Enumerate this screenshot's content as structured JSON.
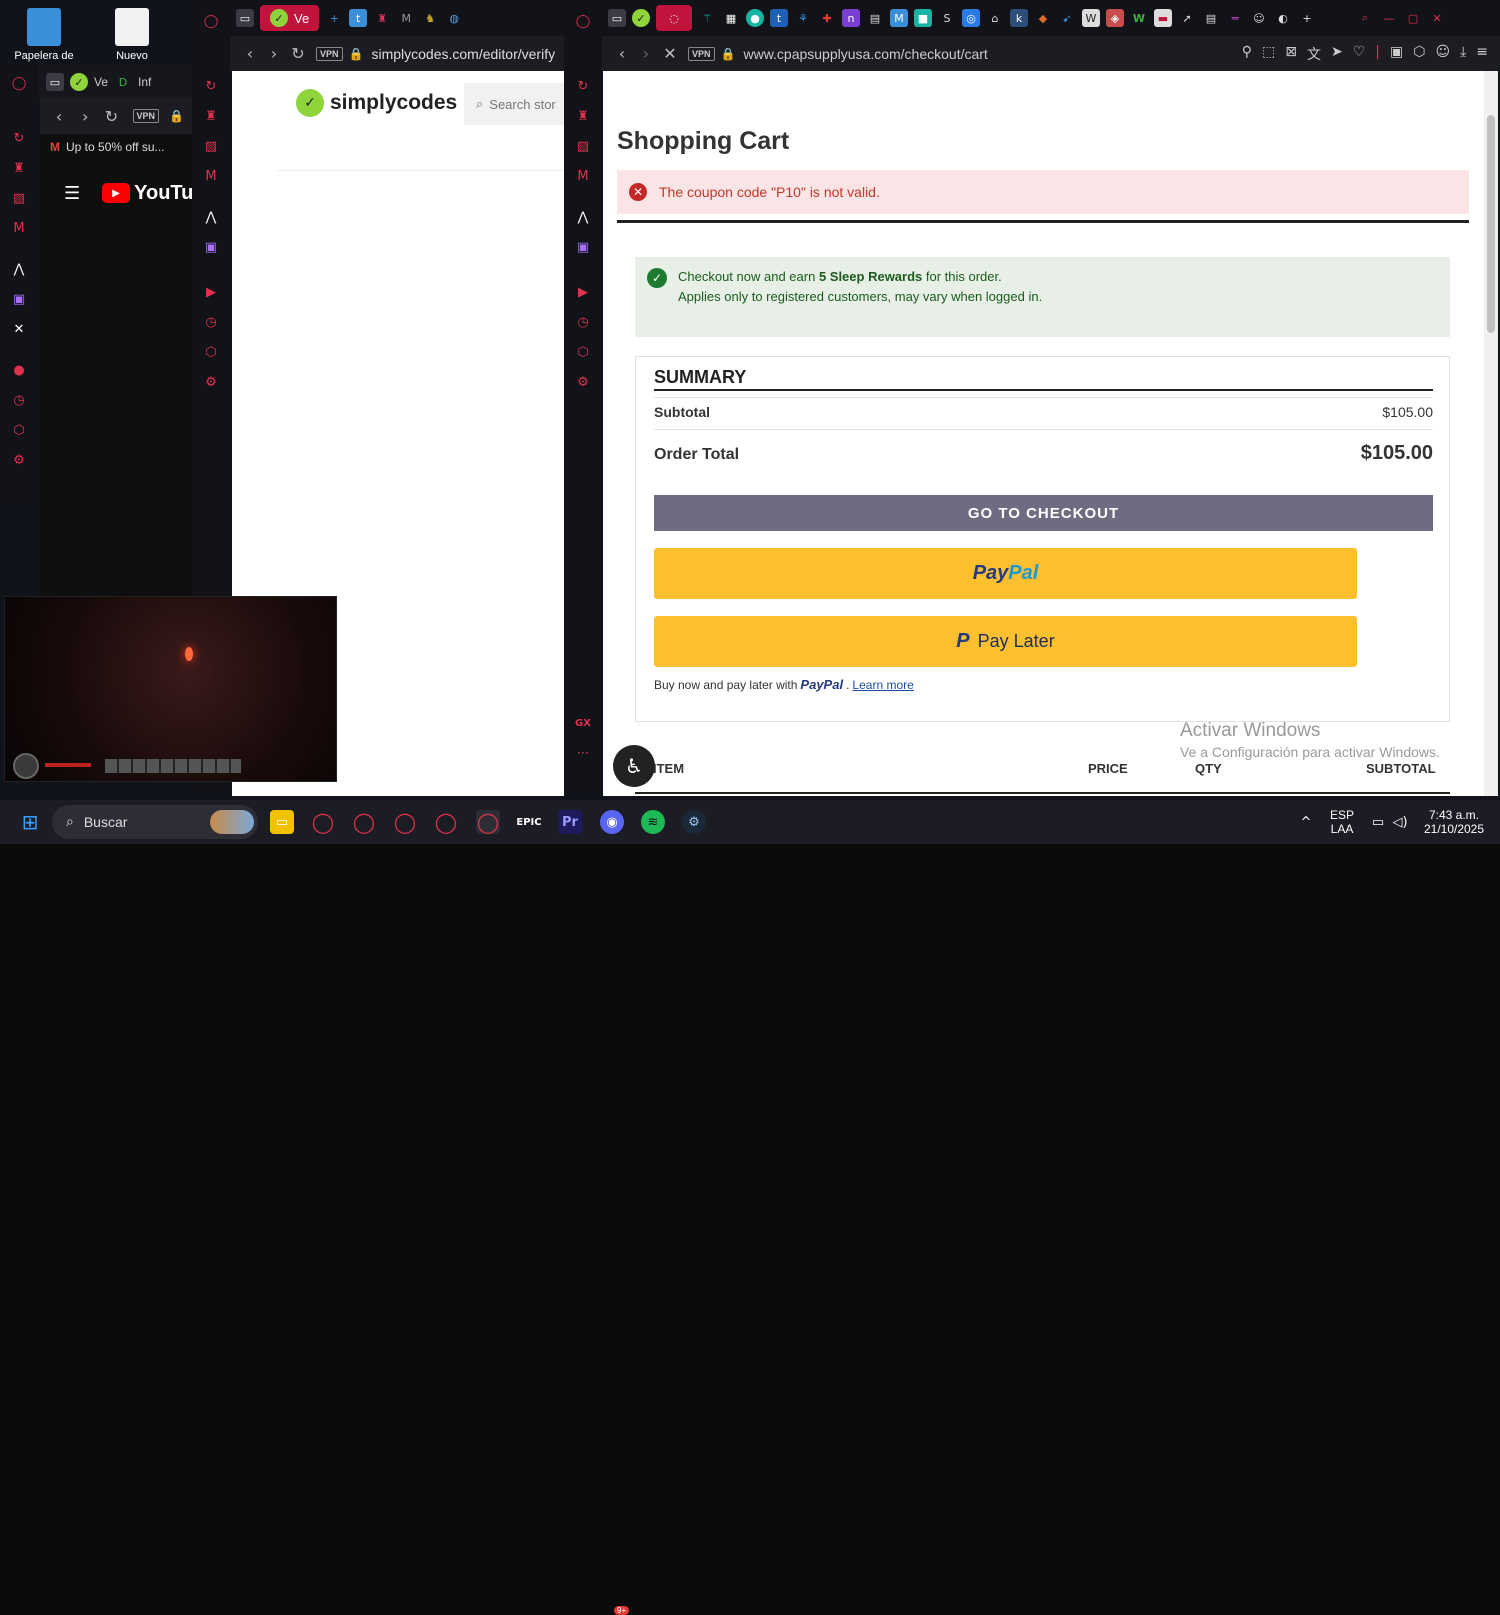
{
  "desktop": {
    "icons": [
      {
        "label": "Papelera de",
        "color": "#3a8fd8"
      },
      {
        "label": "Nuevo",
        "color": "#f2f2f2"
      }
    ]
  },
  "left_window": {
    "tab_labels": [
      "Ve",
      "Inf"
    ],
    "tab_title": "Up to 50% off su...",
    "youtube_label": "YouTube"
  },
  "middle_window": {
    "active_tab_label": "Ve",
    "url": "simplycodes.com/editor/verify",
    "logo_text": "simplycodes",
    "search_placeholder": "Search stor"
  },
  "right_window": {
    "url": "www.cpapsupplyusa.com/checkout/cart",
    "vpn_label": "VPN",
    "page": {
      "title": "Shopping Cart",
      "error_message": "The coupon code \"P10\" is not valid.",
      "rewards": {
        "line1_prefix": "Checkout now and earn ",
        "line1_bold": "5 Sleep Rewards",
        "line1_suffix": " for this order.",
        "line2": "Applies only to registered customers, may vary when logged in."
      },
      "summary": {
        "title": "SUMMARY",
        "subtotal_label": "Subtotal",
        "subtotal_value": "$105.00",
        "order_total_label": "Order Total",
        "order_total_value": "$105.00"
      },
      "checkout_button": "GO TO CHECKOUT",
      "paypal_button": {
        "part1": "Pay",
        "part2": "Pal"
      },
      "paylater_button": {
        "mark": "P",
        "label": "Pay Later"
      },
      "buy_now": {
        "prefix": "Buy now and pay later with",
        "logo": "PayPal",
        "suffix": ".",
        "link": "Learn more"
      },
      "table_headers": {
        "item": "ITEM",
        "price": "PRICE",
        "qty": "QTY",
        "subtotal": "SUBTOTAL"
      }
    }
  },
  "windows_watermark": {
    "line1": "Activar Windows",
    "line2": "Ve a Configuración para activar Windows."
  },
  "taskbar": {
    "search_placeholder": "Buscar",
    "language": "ESP",
    "layout": "LAA",
    "time": "7:43 a.m.",
    "date": "21/10/2025",
    "discord_badge": "9+"
  },
  "colors": {
    "opera_red": "#e0314f",
    "paypal_yellow": "#fcbf30",
    "checkout_gray": "#6f6b80",
    "error_bg": "#fbe4e6",
    "rewards_bg": "#e7efe7"
  }
}
